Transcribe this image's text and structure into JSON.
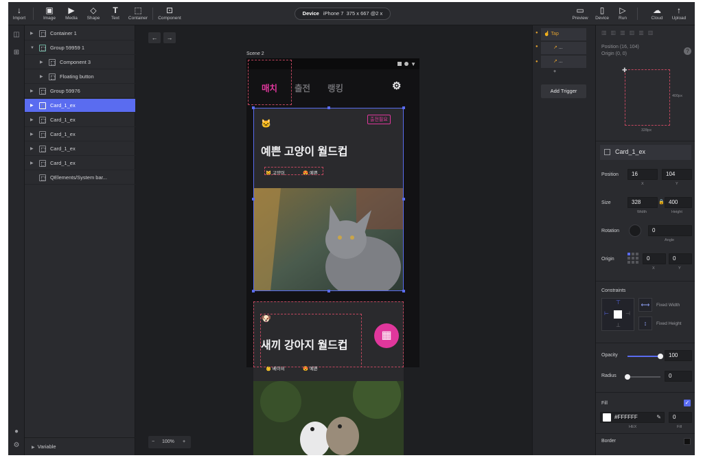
{
  "toolbar": {
    "left": [
      {
        "label": "Import",
        "icon": "download-icon"
      },
      {
        "label": "Image",
        "icon": "image-icon"
      },
      {
        "label": "Media",
        "icon": "media-icon"
      },
      {
        "label": "Shape",
        "icon": "shape-icon"
      },
      {
        "label": "Text",
        "icon": "text-icon"
      },
      {
        "label": "Container",
        "icon": "container-icon"
      },
      {
        "label": "Component",
        "icon": "component-icon"
      }
    ],
    "device": {
      "label": "Device",
      "model": "iPhone 7",
      "size": "375 x 667",
      "scale": "@2 x"
    },
    "right": [
      {
        "label": "Preview",
        "icon": "preview-icon"
      },
      {
        "label": "Device",
        "icon": "device-icon"
      },
      {
        "label": "Run",
        "icon": "play-icon"
      },
      {
        "label": "Cloud",
        "icon": "cloud-icon"
      },
      {
        "label": "Upload",
        "icon": "upload-icon"
      }
    ]
  },
  "layers": [
    {
      "label": "Container 1",
      "expanded": false,
      "selected": false
    },
    {
      "label": "Group 59959 1",
      "expanded": true,
      "selected": false
    },
    {
      "label": "Component 3",
      "expanded": false,
      "selected": false
    },
    {
      "label": "Floating button",
      "expanded": false,
      "selected": false
    },
    {
      "label": "Group 59976",
      "expanded": false,
      "selected": false
    },
    {
      "label": "Card_1_ex",
      "expanded": false,
      "selected": true
    },
    {
      "label": "Card_1_ex",
      "expanded": false,
      "selected": false
    },
    {
      "label": "Card_1_ex",
      "expanded": false,
      "selected": false
    },
    {
      "label": "Card_1_ex",
      "expanded": false,
      "selected": false
    },
    {
      "label": "Card_1_ex",
      "expanded": false,
      "selected": false
    },
    {
      "label": "QElements/System bar...",
      "expanded": false,
      "selected": false
    }
  ],
  "variable_label": "Variable",
  "canvas": {
    "scene_label": "Scene 2",
    "zoom": "100%",
    "zoom_minus": "−",
    "zoom_plus": "+",
    "nav_back": "←",
    "nav_forward": "→"
  },
  "app": {
    "tabs": [
      {
        "label": "매치",
        "active": true
      },
      {
        "label": "출전",
        "active": false
      },
      {
        "label": "랭킹",
        "active": false
      }
    ],
    "cards": [
      {
        "emoji": "🐱",
        "badge": "출전필요",
        "title": "예쁜 고양이 월드컵",
        "tags": [
          "🐱 고양이",
          "😍 예쁜"
        ]
      },
      {
        "emoji": "🐶",
        "title": "새끼 강아지 월드컵",
        "tags": [
          "👶 베이비",
          "😍 예쁜"
        ]
      }
    ]
  },
  "interactions": {
    "trigger": "Tap",
    "actions": [
      "...",
      "..."
    ],
    "add_trigger": "Add Trigger"
  },
  "properties": {
    "position_readout": "Position   (16, 104)",
    "origin_readout": "Origin     (0, 0)",
    "preview_width": "328px",
    "preview_height": "400px",
    "layer_name": "Card_1_ex",
    "position": {
      "label": "Position",
      "x": "16",
      "y": "104",
      "x_sub": "X",
      "y_sub": "Y"
    },
    "size": {
      "label": "Size",
      "width": "328",
      "height": "400",
      "w_sub": "Width",
      "h_sub": "Height"
    },
    "rotation": {
      "label": "Rotation",
      "angle": "0",
      "sub": "Angle"
    },
    "origin": {
      "label": "Origin",
      "x": "0",
      "y": "0",
      "x_sub": "X",
      "y_sub": "Y"
    },
    "constraints": {
      "label": "Constraints",
      "fixed_width": "Fixed Width",
      "fixed_height": "Fixed Height"
    },
    "opacity": {
      "label": "Opacity",
      "value": "100",
      "level": 1.0
    },
    "radius": {
      "label": "Radius",
      "value": "0",
      "level": 0.0
    },
    "fill": {
      "label": "Fill",
      "hex": "#FFFFFF",
      "value": "0",
      "hex_sub": "HEX",
      "value_sub": "Fill",
      "checked": true
    },
    "border": {
      "label": "Border"
    }
  },
  "colors": {
    "accent": "#5a6cf0",
    "brand_pink": "#e0379c",
    "fill_swatch": "#FFFFFF"
  }
}
